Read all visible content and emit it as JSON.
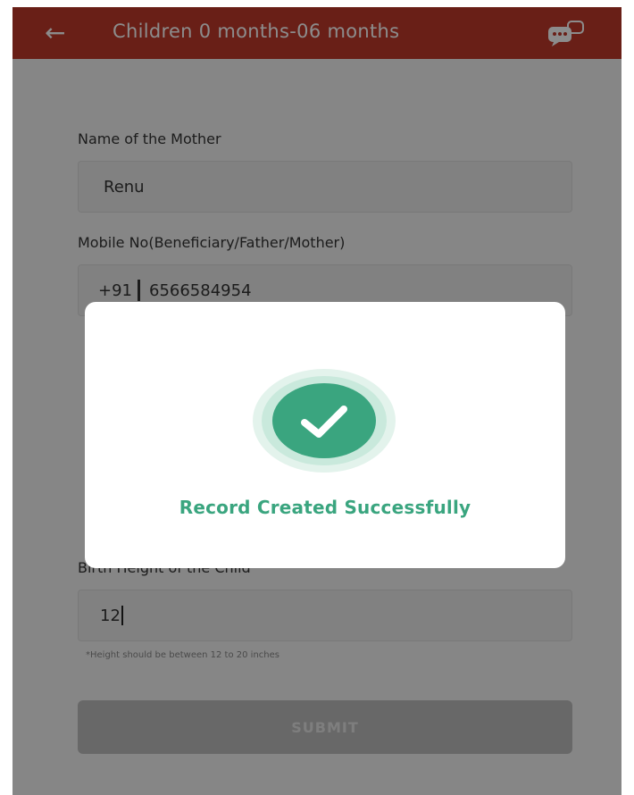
{
  "appbar": {
    "title": "Children 0 months-06 months",
    "back_icon": "back-arrow-icon",
    "chat_icon": "chat-icon",
    "color": "#c0392b"
  },
  "form": {
    "mother_name_label": "Name of the Mother",
    "mother_name_value": "Renu",
    "mobile_label": "Mobile No(Beneficiary/Father/Mother)",
    "mobile_prefix": "+91",
    "mobile_value": "6566584954",
    "height_label": "Birth Height of the Child",
    "height_value": "12",
    "height_hint": "*Height should be between 12 to 20 inches",
    "submit_label": "SUBMIT"
  },
  "dialog": {
    "icon": "check-circle-icon",
    "message": "Record Created Successfully",
    "accent": "#3aa57f"
  }
}
